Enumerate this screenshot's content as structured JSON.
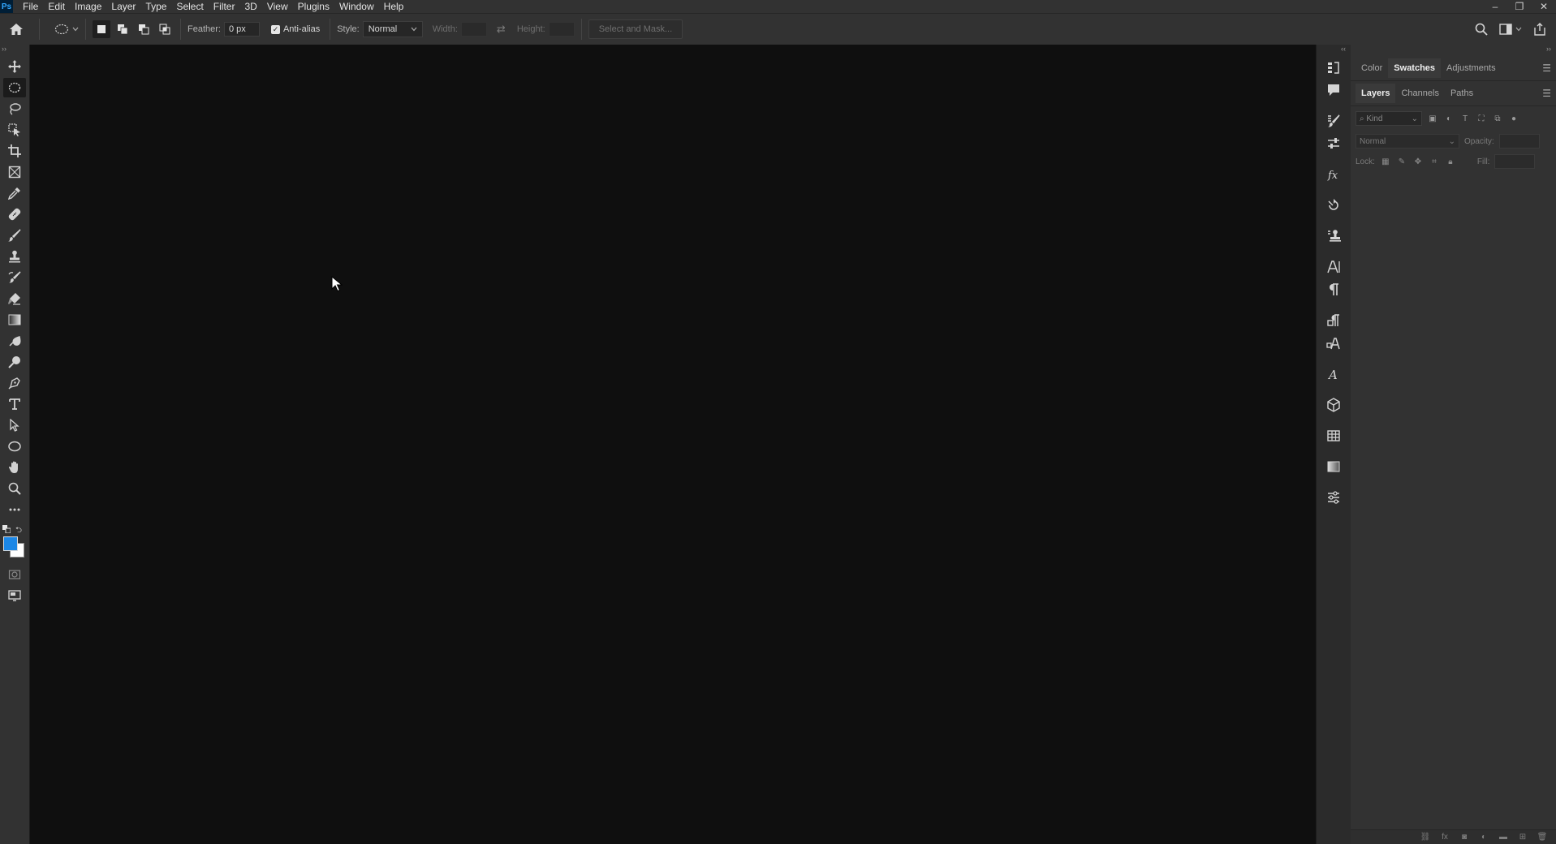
{
  "app": {
    "logo": "Ps",
    "menu": [
      "File",
      "Edit",
      "Image",
      "Layer",
      "Type",
      "Select",
      "Filter",
      "3D",
      "View",
      "Plugins",
      "Window",
      "Help"
    ]
  },
  "window_controls": {
    "minimize": "–",
    "restore": "❐",
    "close": "✕"
  },
  "options_bar": {
    "feather_label": "Feather:",
    "feather_value": "0 px",
    "antialias_label": "Anti-alias",
    "antialias_checked": true,
    "style_label": "Style:",
    "style_value": "Normal",
    "width_label": "Width:",
    "width_value": "",
    "height_label": "Height:",
    "height_value": "",
    "select_mask_label": "Select and Mask..."
  },
  "toolbar": {
    "tools": [
      {
        "name": "move-tool"
      },
      {
        "name": "elliptical-marquee-tool",
        "active": true
      },
      {
        "name": "lasso-tool"
      },
      {
        "name": "object-selection-tool"
      },
      {
        "name": "crop-tool"
      },
      {
        "name": "frame-tool"
      },
      {
        "name": "eyedropper-tool"
      },
      {
        "name": "spot-healing-tool"
      },
      {
        "name": "brush-tool"
      },
      {
        "name": "clone-stamp-tool"
      },
      {
        "name": "history-brush-tool"
      },
      {
        "name": "eraser-tool"
      },
      {
        "name": "gradient-tool"
      },
      {
        "name": "blur-tool"
      },
      {
        "name": "dodge-tool"
      },
      {
        "name": "pen-tool"
      },
      {
        "name": "type-tool"
      },
      {
        "name": "path-selection-tool"
      },
      {
        "name": "ellipse-tool"
      },
      {
        "name": "hand-tool"
      },
      {
        "name": "zoom-tool"
      },
      {
        "name": "edit-toolbar"
      }
    ],
    "foreground_color": "#1c87e6",
    "background_color": "#ffffff"
  },
  "panels": {
    "top_tabs": [
      "Color",
      "Swatches",
      "Adjustments"
    ],
    "top_active": "Swatches",
    "layer_tabs": [
      "Layers",
      "Channels",
      "Paths"
    ],
    "layer_active": "Layers",
    "kind_placeholder": "Kind",
    "blend_mode": "Normal",
    "opacity_label": "Opacity:",
    "lock_label": "Lock:",
    "fill_label": "Fill:"
  },
  "colors": {
    "accent": "#1c87e6",
    "chrome": "#323232",
    "canvas": "#0f0f0f"
  }
}
